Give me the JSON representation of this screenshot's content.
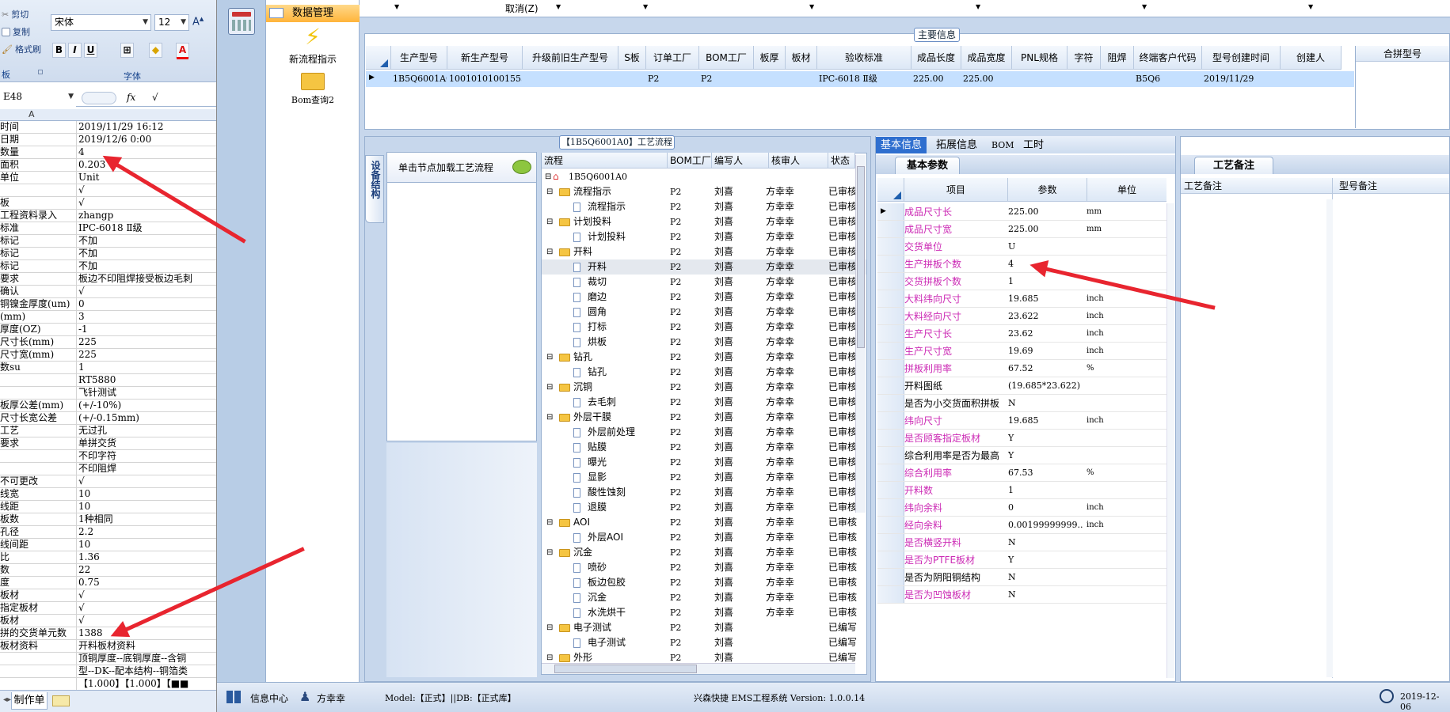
{
  "excel": {
    "clipboard": {
      "cut": "剪切",
      "copy": "复制",
      "format_painter": "格式刷",
      "group": "板"
    },
    "font": {
      "name": "宋体",
      "size": "12",
      "group": "字体",
      "bold": "B",
      "italic": "I",
      "underline": "U",
      "color_a": "A"
    },
    "name_box": "E48",
    "fx": "fx",
    "formula": "√",
    "column_header": "A",
    "rows": [
      {
        "a": "时间",
        "b": "2019/11/29 16:12"
      },
      {
        "a": "日期",
        "b": "2019/12/6 0:00"
      },
      {
        "a": "数量",
        "b": "4"
      },
      {
        "a": "面积",
        "b": "0.203"
      },
      {
        "a": "单位",
        "b": "Unit"
      },
      {
        "a": "",
        "b": "√"
      },
      {
        "a": "板",
        "b": "√"
      },
      {
        "a": "工程资料录入",
        "b": "zhangp"
      },
      {
        "a": "标准",
        "b": "IPC-6018 Ⅱ级"
      },
      {
        "a": "标记",
        "b": "不加"
      },
      {
        "a": "标记",
        "b": "不加"
      },
      {
        "a": "标记",
        "b": "不加"
      },
      {
        "a": "要求",
        "b": "板边不印阻焊接受板边毛刺"
      },
      {
        "a": "确认",
        "b": "√"
      },
      {
        "a": "铜镍金厚度(um)",
        "b": "0"
      },
      {
        "a": "(mm)",
        "b": "3"
      },
      {
        "a": "厚度(OZ)",
        "b": "-1"
      },
      {
        "a": "尺寸长(mm)",
        "b": "225"
      },
      {
        "a": "尺寸宽(mm)",
        "b": "225"
      },
      {
        "a": "数su",
        "b": "1"
      },
      {
        "a": "",
        "b": "RT5880"
      },
      {
        "a": "",
        "b": "飞针测试"
      },
      {
        "a": "板厚公差(mm)",
        "b": "(+/-10%)"
      },
      {
        "a": "尺寸长宽公差",
        "b": "(+/-0.15mm)"
      },
      {
        "a": "工艺",
        "b": "无过孔"
      },
      {
        "a": "要求",
        "b": "单拼交货"
      },
      {
        "a": "",
        "b": "不印字符"
      },
      {
        "a": "",
        "b": "不印阻焊"
      },
      {
        "a": "不可更改",
        "b": "√"
      },
      {
        "a": "线宽",
        "b": "10"
      },
      {
        "a": "线距",
        "b": "10"
      },
      {
        "a": "板数",
        "b": "1种相同"
      },
      {
        "a": "孔径",
        "b": "2.2"
      },
      {
        "a": "线间距",
        "b": "10"
      },
      {
        "a": "比",
        "b": "1.36"
      },
      {
        "a": "数",
        "b": "22"
      },
      {
        "a": "度",
        "b": "0.75"
      },
      {
        "a": "板材",
        "b": "√"
      },
      {
        "a": "指定板材",
        "b": "√"
      },
      {
        "a": "板材",
        "b": "√"
      },
      {
        "a": "拼的交货单元数",
        "b": "1388"
      },
      {
        "a": "板材资料",
        "b": "开料板材资料"
      },
      {
        "a": "",
        "b": "顶铜厚度--底铜厚度--含铜"
      },
      {
        "a": "",
        "b": "型--DK--配本结构--铜箔类"
      },
      {
        "a": "",
        "b": "【1.000】【1.000】【■■"
      }
    ],
    "sheet_tab": "制作单"
  },
  "nav": {
    "section": "数据管理",
    "items": [
      "新流程指示",
      "Bom查询2"
    ]
  },
  "menu_strip": {
    "cancel": "取消(Z)"
  },
  "main_info": {
    "title": "主要信息",
    "columns": [
      "生产型号",
      "新生产型号",
      "升级前旧生产型号",
      "S板",
      "订单工厂",
      "BOM工厂",
      "板厚",
      "板材",
      "验收标准",
      "成品长度",
      "成品宽度",
      "PNL规格",
      "字符",
      "阻焊",
      "终端客户代码",
      "型号创建时间",
      "创建人"
    ],
    "row": [
      "1B5Q6001A0",
      "10010101001555",
      "",
      "",
      "P2",
      "P2",
      "",
      "",
      "IPC-6018 Ⅱ级",
      "225.00",
      "225.00",
      "",
      "",
      "",
      "B5Q6",
      "2019/11/29",
      ""
    ],
    "merge_header": "合拼型号"
  },
  "process": {
    "title": "【1B5Q6001A0】工艺流程",
    "side_tab": "设备结构",
    "click_hint": "单击节点加载工艺流程",
    "columns": [
      "流程",
      "BOM工厂",
      "编写人",
      "核审人",
      "状态"
    ],
    "root": "1B5Q6001A0",
    "rows": [
      {
        "level": 1,
        "type": "folder",
        "name": "流程指示",
        "bom": "P2",
        "writer": "刘喜",
        "reviewer": "方幸幸",
        "status": "已审核"
      },
      {
        "level": 2,
        "type": "doc",
        "name": "流程指示",
        "bom": "P2",
        "writer": "刘喜",
        "reviewer": "方幸幸",
        "status": "已审核"
      },
      {
        "level": 1,
        "type": "folder",
        "name": "计划投料",
        "bom": "P2",
        "writer": "刘喜",
        "reviewer": "方幸幸",
        "status": "已审核"
      },
      {
        "level": 2,
        "type": "doc",
        "name": "计划投料",
        "bom": "P2",
        "writer": "刘喜",
        "reviewer": "方幸幸",
        "status": "已审核"
      },
      {
        "level": 1,
        "type": "folder",
        "name": "开料",
        "bom": "P2",
        "writer": "刘喜",
        "reviewer": "方幸幸",
        "status": "已审核"
      },
      {
        "level": 2,
        "type": "doc",
        "name": "开料",
        "bom": "P2",
        "writer": "刘喜",
        "reviewer": "方幸幸",
        "status": "已审核"
      },
      {
        "level": 2,
        "type": "doc",
        "name": "裁切",
        "bom": "P2",
        "writer": "刘喜",
        "reviewer": "方幸幸",
        "status": "已审核"
      },
      {
        "level": 2,
        "type": "doc",
        "name": "磨边",
        "bom": "P2",
        "writer": "刘喜",
        "reviewer": "方幸幸",
        "status": "已审核"
      },
      {
        "level": 2,
        "type": "doc",
        "name": "圆角",
        "bom": "P2",
        "writer": "刘喜",
        "reviewer": "方幸幸",
        "status": "已审核"
      },
      {
        "level": 2,
        "type": "doc",
        "name": "打标",
        "bom": "P2",
        "writer": "刘喜",
        "reviewer": "方幸幸",
        "status": "已审核"
      },
      {
        "level": 2,
        "type": "doc",
        "name": "烘板",
        "bom": "P2",
        "writer": "刘喜",
        "reviewer": "方幸幸",
        "status": "已审核"
      },
      {
        "level": 1,
        "type": "folder",
        "name": "钻孔",
        "bom": "P2",
        "writer": "刘喜",
        "reviewer": "方幸幸",
        "status": "已审核"
      },
      {
        "level": 2,
        "type": "doc",
        "name": "钻孔",
        "bom": "P2",
        "writer": "刘喜",
        "reviewer": "方幸幸",
        "status": "已审核"
      },
      {
        "level": 1,
        "type": "folder",
        "name": "沉铜",
        "bom": "P2",
        "writer": "刘喜",
        "reviewer": "方幸幸",
        "status": "已审核"
      },
      {
        "level": 2,
        "type": "doc",
        "name": "去毛刺",
        "bom": "P2",
        "writer": "刘喜",
        "reviewer": "方幸幸",
        "status": "已审核"
      },
      {
        "level": 1,
        "type": "folder",
        "name": "外层干膜",
        "bom": "P2",
        "writer": "刘喜",
        "reviewer": "方幸幸",
        "status": "已审核"
      },
      {
        "level": 2,
        "type": "doc",
        "name": "外层前处理",
        "bom": "P2",
        "writer": "刘喜",
        "reviewer": "方幸幸",
        "status": "已审核"
      },
      {
        "level": 2,
        "type": "doc",
        "name": "贴膜",
        "bom": "P2",
        "writer": "刘喜",
        "reviewer": "方幸幸",
        "status": "已审核"
      },
      {
        "level": 2,
        "type": "doc",
        "name": "曝光",
        "bom": "P2",
        "writer": "刘喜",
        "reviewer": "方幸幸",
        "status": "已审核"
      },
      {
        "level": 2,
        "type": "doc",
        "name": "显影",
        "bom": "P2",
        "writer": "刘喜",
        "reviewer": "方幸幸",
        "status": "已审核"
      },
      {
        "level": 2,
        "type": "doc",
        "name": "酸性蚀刻",
        "bom": "P2",
        "writer": "刘喜",
        "reviewer": "方幸幸",
        "status": "已审核"
      },
      {
        "level": 2,
        "type": "doc",
        "name": "退膜",
        "bom": "P2",
        "writer": "刘喜",
        "reviewer": "方幸幸",
        "status": "已审核"
      },
      {
        "level": 1,
        "type": "folder",
        "name": "AOI",
        "bom": "P2",
        "writer": "刘喜",
        "reviewer": "方幸幸",
        "status": "已审核"
      },
      {
        "level": 2,
        "type": "doc",
        "name": "外层AOI",
        "bom": "P2",
        "writer": "刘喜",
        "reviewer": "方幸幸",
        "status": "已审核"
      },
      {
        "level": 1,
        "type": "folder",
        "name": "沉金",
        "bom": "P2",
        "writer": "刘喜",
        "reviewer": "方幸幸",
        "status": "已审核"
      },
      {
        "level": 2,
        "type": "doc",
        "name": "喷砂",
        "bom": "P2",
        "writer": "刘喜",
        "reviewer": "方幸幸",
        "status": "已审核"
      },
      {
        "level": 2,
        "type": "doc",
        "name": "板边包胶",
        "bom": "P2",
        "writer": "刘喜",
        "reviewer": "方幸幸",
        "status": "已审核"
      },
      {
        "level": 2,
        "type": "doc",
        "name": "沉金",
        "bom": "P2",
        "writer": "刘喜",
        "reviewer": "方幸幸",
        "status": "已审核"
      },
      {
        "level": 2,
        "type": "doc",
        "name": "水洗烘干",
        "bom": "P2",
        "writer": "刘喜",
        "reviewer": "方幸幸",
        "status": "已审核"
      },
      {
        "level": 1,
        "type": "folder",
        "name": "电子测试",
        "bom": "P2",
        "writer": "刘喜",
        "reviewer": "",
        "status": "已编写"
      },
      {
        "level": 2,
        "type": "doc",
        "name": "电子测试",
        "bom": "P2",
        "writer": "刘喜",
        "reviewer": "",
        "status": "已编写"
      },
      {
        "level": 1,
        "type": "folder",
        "name": "外形",
        "bom": "P2",
        "writer": "刘喜",
        "reviewer": "",
        "status": "已编写"
      }
    ]
  },
  "basic_info": {
    "tabs": [
      "基本信息",
      "拓展信息",
      "BOM",
      "工时"
    ],
    "subtab": "基本参数",
    "columns": [
      "项目",
      "参数",
      "单位"
    ],
    "rows": [
      {
        "k": "成品尺寸长",
        "v": "225.00",
        "u": "mm",
        "c": "m"
      },
      {
        "k": "成品尺寸宽",
        "v": "225.00",
        "u": "mm",
        "c": "m"
      },
      {
        "k": "交货单位",
        "v": "U",
        "u": "",
        "c": "m"
      },
      {
        "k": "生产拼板个数",
        "v": "4",
        "u": "",
        "c": "m"
      },
      {
        "k": "交货拼板个数",
        "v": "1",
        "u": "",
        "c": "m"
      },
      {
        "k": "大料纬向尺寸",
        "v": "19.685",
        "u": "inch",
        "c": "m"
      },
      {
        "k": "大料经向尺寸",
        "v": "23.622",
        "u": "inch",
        "c": "m"
      },
      {
        "k": "生产尺寸长",
        "v": "23.62",
        "u": "inch",
        "c": "m"
      },
      {
        "k": "生产尺寸宽",
        "v": "19.69",
        "u": "inch",
        "c": "m"
      },
      {
        "k": "拼板利用率",
        "v": "67.52",
        "u": "%",
        "c": "m"
      },
      {
        "k": "开料图纸",
        "v": "(19.685*23.622)",
        "u": "",
        "c": "b"
      },
      {
        "k": "是否为小交货面积拼板",
        "v": "N",
        "u": "",
        "c": "b"
      },
      {
        "k": "纬向尺寸",
        "v": "19.685",
        "u": "inch",
        "c": "m"
      },
      {
        "k": "是否顾客指定板材",
        "v": "Y",
        "u": "",
        "c": "m"
      },
      {
        "k": "综合利用率是否为最高",
        "v": "Y",
        "u": "",
        "c": "b"
      },
      {
        "k": "综合利用率",
        "v": "67.53",
        "u": "%",
        "c": "m"
      },
      {
        "k": "开料数",
        "v": "1",
        "u": "",
        "c": "m"
      },
      {
        "k": "纬向余料",
        "v": "0",
        "u": "inch",
        "c": "m"
      },
      {
        "k": "经向余料",
        "v": "0.00199999999...",
        "u": "inch",
        "c": "m"
      },
      {
        "k": "是否横竖开料",
        "v": "N",
        "u": "",
        "c": "m"
      },
      {
        "k": "是否为PTFE板材",
        "v": "Y",
        "u": "",
        "c": "m"
      },
      {
        "k": "是否为阴阳铜结构",
        "v": "N",
        "u": "",
        "c": "b"
      },
      {
        "k": "是否为凹蚀板材",
        "v": "N",
        "u": "",
        "c": "m"
      }
    ]
  },
  "remarks": {
    "title": "工艺备注",
    "col1": "工艺备注",
    "col2": "型号备注"
  },
  "status_bar": {
    "info_center": "信息中心",
    "user": "方幸幸",
    "model": "Model:【正式】||DB:【正式库】",
    "system": "兴森快捷 EMS工程系统 Version: 1.0.0.14",
    "date": "2019-12-06"
  },
  "colors": {
    "accent": "#e8252f",
    "highlight_key": "#cc2bb5",
    "tab_active": "#2f6fcf"
  }
}
